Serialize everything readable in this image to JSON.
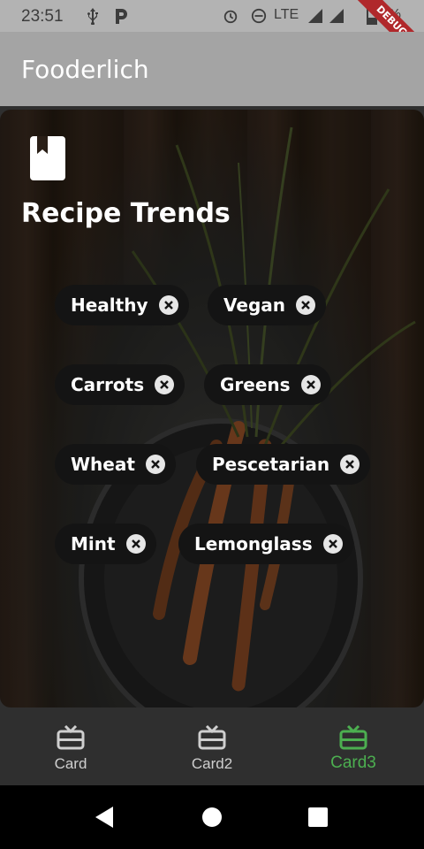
{
  "status_bar": {
    "time": "23:51",
    "network": "LTE",
    "battery_text": "2 %",
    "debug_label": "DEBUG"
  },
  "app_bar": {
    "title": "Fooderlich"
  },
  "card": {
    "title": "Recipe Trends",
    "chips": [
      {
        "label": "Healthy"
      },
      {
        "label": "Vegan"
      },
      {
        "label": "Carrots"
      },
      {
        "label": "Greens"
      },
      {
        "label": "Wheat"
      },
      {
        "label": "Pescetarian"
      },
      {
        "label": "Mint"
      },
      {
        "label": "Lemonglass"
      }
    ]
  },
  "bottom_nav": {
    "items": [
      {
        "label": "Card",
        "icon": "card-giftcard-icon"
      },
      {
        "label": "Card2",
        "icon": "card-giftcard-icon"
      },
      {
        "label": "Card3",
        "icon": "card-giftcard-icon"
      }
    ],
    "active_index": 2,
    "active_color": "#4caf50",
    "inactive_color": "#cfcfcf"
  },
  "system_nav": {
    "buttons": [
      "back",
      "home",
      "recents"
    ]
  }
}
